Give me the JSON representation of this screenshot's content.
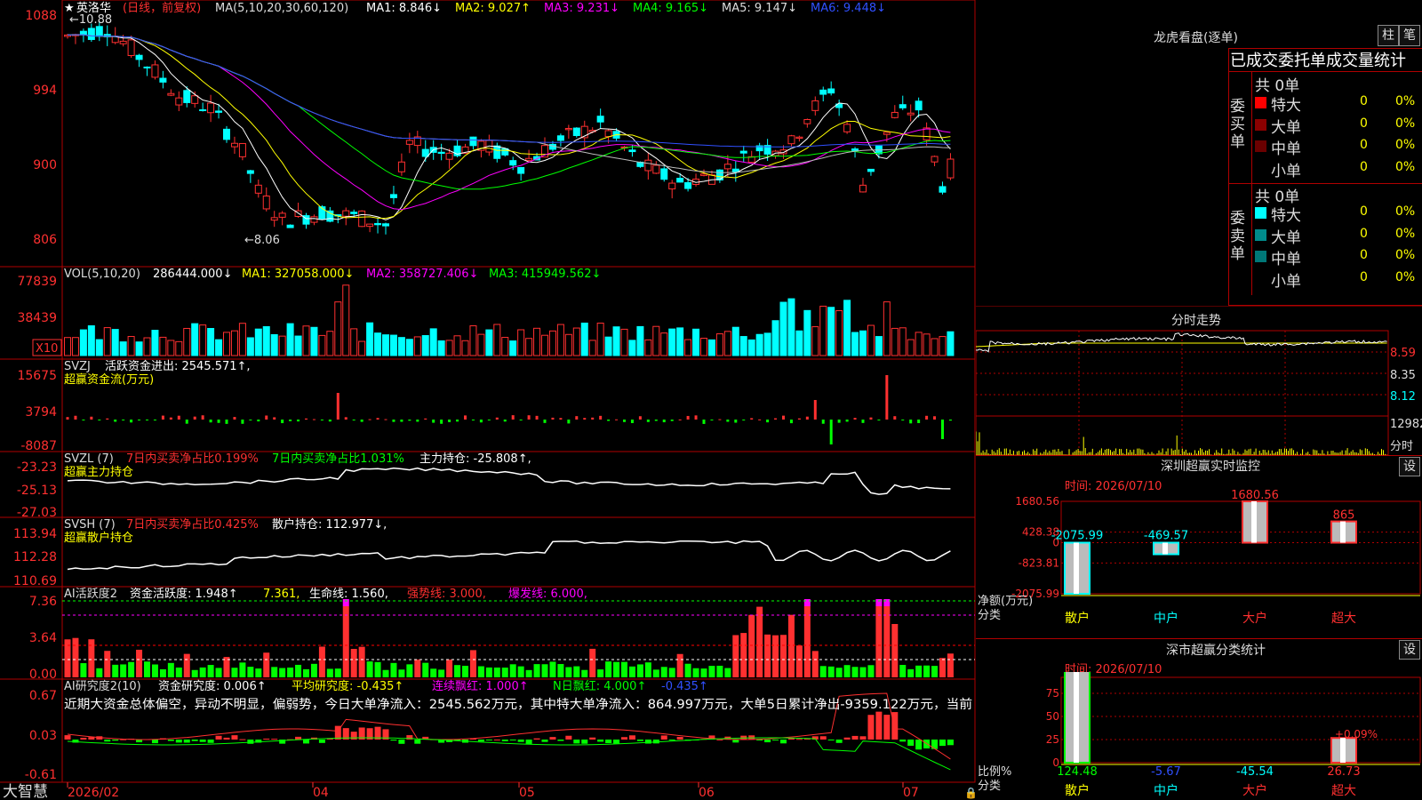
{
  "header": {
    "name": "英洛华",
    "mode": "(日线，前复权)",
    "ma": "MA(5,10,20,30,60,120)",
    "ma1": "MA1: 8.846↓",
    "ma2": "MA2: 9.027↑",
    "ma3": "MA3: 9.231↓",
    "ma4": "MA4: 9.165↓",
    "ma5": "MA5: 9.147↓",
    "ma6": "MA6: 9.448↓",
    "high_mark": "10.88",
    "low_mark": "8.06"
  },
  "price_axis": [
    "1088",
    "994",
    "900",
    "806"
  ],
  "vol": {
    "label": "VOL(5,10,20)",
    "val": "286444.000↓",
    "ma1": "MA1: 327058.000↓",
    "ma2": "MA2: 358727.406↓",
    "ma3": "MA3: 415949.562↓",
    "axis": [
      "77839",
      "38439"
    ],
    "unit": "X10"
  },
  "svzj": {
    "label": "SVZJ",
    "text": "活跃资金进出: 2545.571↑,",
    "sub": "超赢资金流(万元)",
    "axis": [
      "15675",
      "3794",
      "-8087"
    ]
  },
  "svzl": {
    "label": "SVZL (7)",
    "t1": "7日内买卖净占比0.199%",
    "t2": "7日内买卖净占比1.031%",
    "t3": "主力持仓: -25.808↑,",
    "sub": "超赢主力持仓",
    "axis": [
      "-23.23",
      "-25.13",
      "-27.03"
    ]
  },
  "svsh": {
    "label": "SVSH (7)",
    "t1": "7日内买卖净占比0.425%",
    "t2": "散户持仓: 112.977↓,",
    "sub": "超赢散户持仓",
    "axis": [
      "113.94",
      "112.28",
      "110.69"
    ]
  },
  "ai1": {
    "label": "AI活跃度2",
    "t1": "资金活跃度: 1.948↑",
    "t2": "7.361,",
    "t3": "生命线: 1.560,",
    "t4": "强势线: 3.000,",
    "t5": "爆发线: 6.000,",
    "axis": [
      "7.36",
      "3.64",
      "0.00"
    ]
  },
  "ai2": {
    "label": "AI研究度2(10)",
    "t1": "资金研究度: 0.006↑",
    "t2": "平均研究度: -0.435↑",
    "t3": "连续飘红: 1.000↑",
    "t4": "N日飘红: 4.000↑",
    "t5": "-0.435↑",
    "axis": [
      "0.67",
      "0.03",
      "-0.61"
    ],
    "comment": "近期大资金总体偏空，异动不明显，偏弱势，今日大单净流入：2545.562万元，其中特大单净流入：864.997万元，大单5日累计净出-9359.122万元，当前"
  },
  "footer": {
    "brand": "大智慧",
    "months": [
      "2026/02",
      "04",
      "05",
      "06",
      "07"
    ]
  },
  "dragon": {
    "title": "龙虎看盘(逐单)",
    "btn1": "柱",
    "btn2": "笔",
    "tabs": [
      "已成交",
      "委托单",
      "成交量统计"
    ],
    "buy_label": "委买单",
    "sell_label": "委卖单",
    "buy_total": "共 0单",
    "sell_total": "共 0单",
    "buy_rows": [
      {
        "name": "特大",
        "n": "0",
        "p": "0%",
        "color": "#ff0000"
      },
      {
        "name": "大单",
        "n": "0",
        "p": "0%",
        "color": "#8b0000"
      },
      {
        "name": "中单",
        "n": "0",
        "p": "0%",
        "color": "#6b0000"
      },
      {
        "name": "小单",
        "n": "0",
        "p": "0%",
        "color": "#000000"
      }
    ],
    "sell_rows": [
      {
        "name": "特大",
        "n": "0",
        "p": "0%",
        "color": "#00ffff"
      },
      {
        "name": "大单",
        "n": "0",
        "p": "0%",
        "color": "#008b8b"
      },
      {
        "name": "中单",
        "n": "0",
        "p": "0%",
        "color": "#007777"
      },
      {
        "name": "小单",
        "n": "0",
        "p": "0%",
        "color": "#000000"
      }
    ]
  },
  "intraday": {
    "title": "分时走势",
    "axis": [
      "8.59",
      "8.35",
      "8.12"
    ],
    "vol_axis": "12982",
    "unit": "分时"
  },
  "monitor": {
    "title": "深圳超赢实时监控",
    "btn": "设",
    "time": "时间: 2026/07/10",
    "axis": [
      "1680.56",
      "428.38",
      "0",
      "-823.81",
      "-2075.99"
    ],
    "unit1": "净额(万元)",
    "unit2": "分类",
    "cats": [
      "散户",
      "中户",
      "大户",
      "超大"
    ],
    "values": [
      -2075.99,
      -469.57,
      1680.56,
      865
    ],
    "labels": [
      "-2075.99",
      "-469.57",
      "1680.56",
      "865"
    ]
  },
  "classify": {
    "title": "深市超赢分类统计",
    "btn": "设",
    "time": "时间: 2026/07/10",
    "axis": [
      "75",
      "50",
      "25",
      "0"
    ],
    "unit1": "比例%",
    "unit2": "分类",
    "cats": [
      "散户",
      "中户",
      "大户",
      "超大"
    ],
    "values": [
      124.48,
      -5.67,
      -45.54,
      26.73
    ],
    "labels": [
      "124.48",
      "-5.67",
      "-45.54",
      "26.73"
    ],
    "extra": "+0.09%"
  }
}
